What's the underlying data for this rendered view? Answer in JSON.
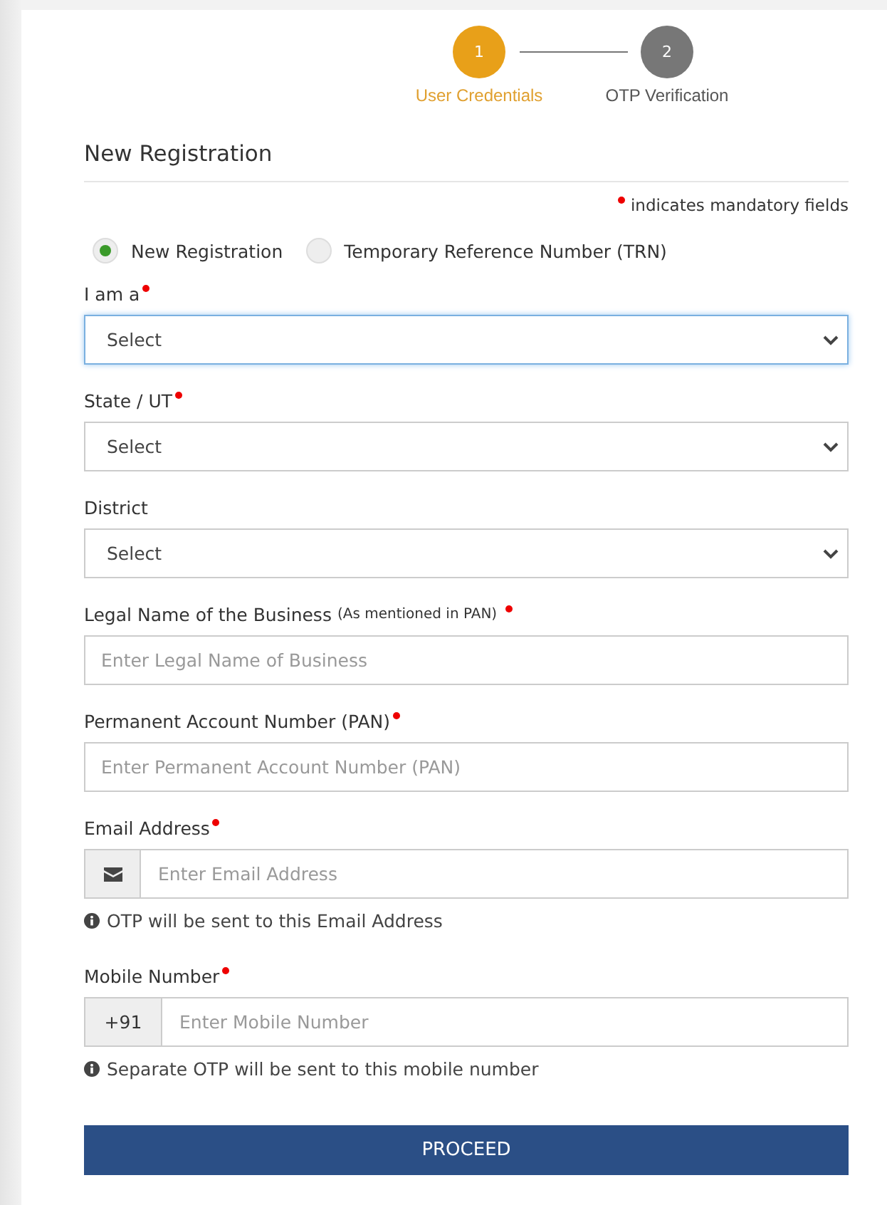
{
  "steps": [
    {
      "number": "1",
      "label": "User Credentials",
      "selected": true
    },
    {
      "number": "2",
      "label": "OTP Verification",
      "selected": false
    }
  ],
  "title": "New Registration",
  "mandatory_note": "indicates mandatory fields",
  "registration_type": [
    {
      "label": "New Registration",
      "selected": true
    },
    {
      "label": "Temporary Reference Number (TRN)",
      "selected": false
    }
  ],
  "fields": [
    {
      "kind": "select",
      "label": "I am a",
      "required": true,
      "value": "Select",
      "focused": true
    },
    {
      "kind": "select",
      "label": "State / UT",
      "required": true,
      "value": "Select",
      "focused": false
    },
    {
      "kind": "select",
      "label": "District",
      "required": false,
      "value": "Select",
      "focused": false
    },
    {
      "kind": "text",
      "label": "Legal Name of the Business",
      "note": "(As mentioned in PAN)",
      "required": true,
      "placeholder": "Enter Legal Name of Business",
      "focused": false
    },
    {
      "kind": "text",
      "label": "Permanent Account Number (PAN)",
      "required": true,
      "placeholder": "Enter Permanent Account Number (PAN)",
      "focused": false
    },
    {
      "kind": "email",
      "label": "Email Address",
      "required": true,
      "placeholder": "Enter Email Address",
      "hint": "OTP will be sent to this Email Address",
      "focused": false
    },
    {
      "kind": "mobile",
      "label": "Mobile Number",
      "required": true,
      "prefix": "+91",
      "placeholder": "Enter Mobile Number",
      "hint": "Separate OTP will be sent to this mobile number",
      "focused": false
    }
  ],
  "submit": "PROCEED"
}
